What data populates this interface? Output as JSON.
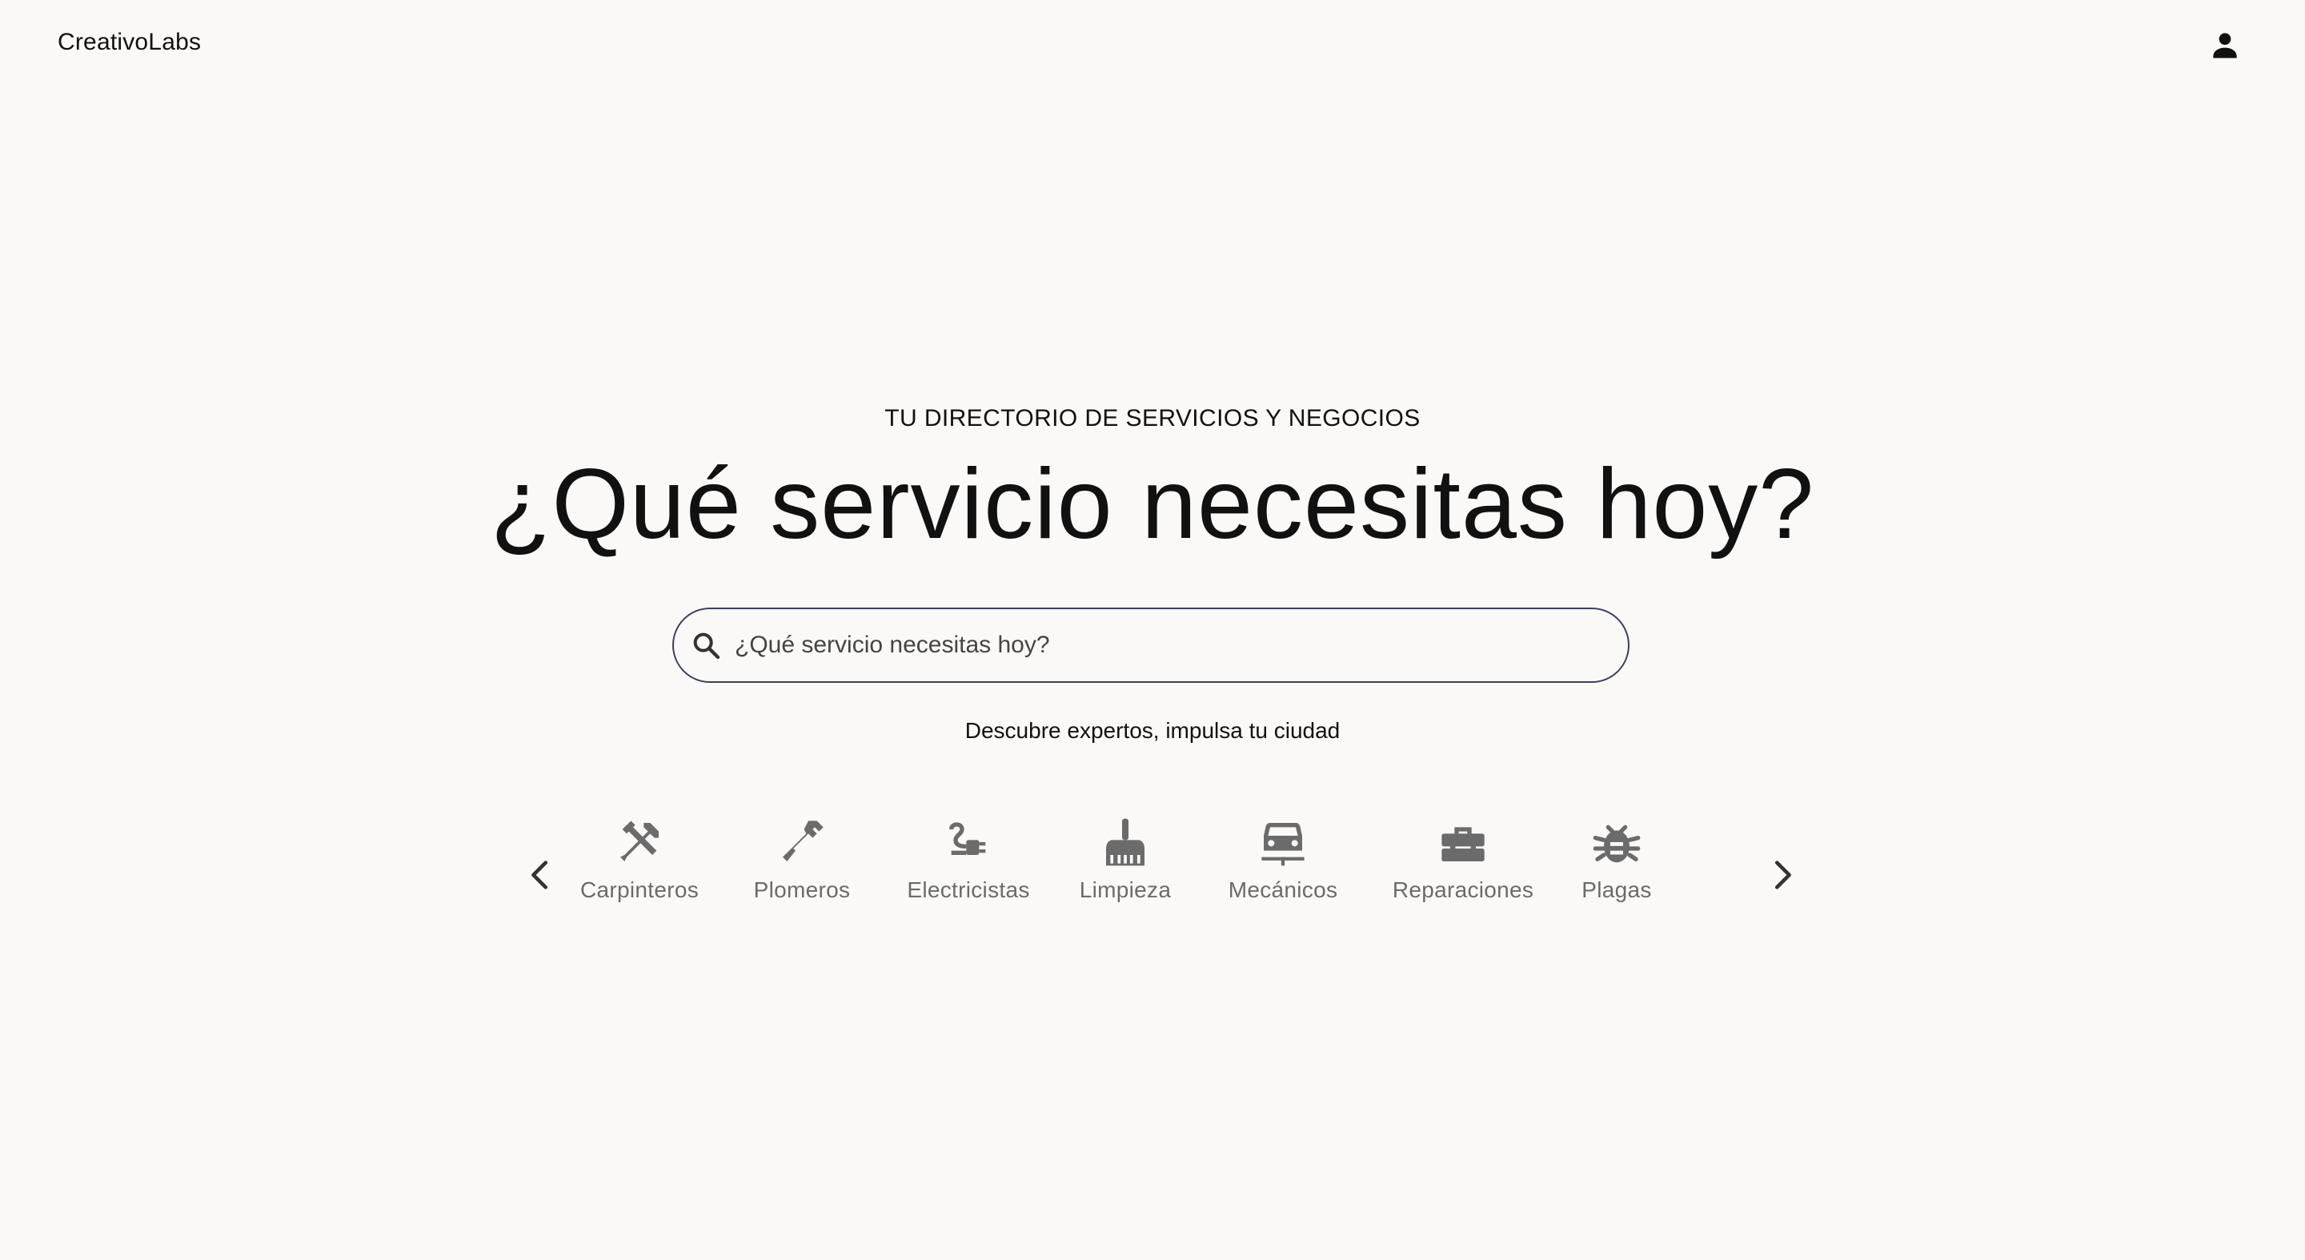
{
  "brand": "CreativoLabs",
  "header": {
    "account_icon": "person-icon"
  },
  "hero": {
    "eyebrow": "TU DIRECTORIO DE SERVICIOS Y NEGOCIOS",
    "headline": "¿Qué servicio necesitas hoy?",
    "search_placeholder": "¿Qué servicio necesitas hoy?",
    "tagline": "Descubre expertos, impulsa tu ciudad"
  },
  "categories": [
    {
      "label": "Carpinteros",
      "icon": "carpentry-tools-icon"
    },
    {
      "label": "Plomeros",
      "icon": "plumbing-wrench-icon"
    },
    {
      "label": "Electricistas",
      "icon": "electrical-plug-icon"
    },
    {
      "label": "Limpieza",
      "icon": "cleaning-broom-icon"
    },
    {
      "label": "Mecánicos",
      "icon": "car-icon"
    },
    {
      "label": "Reparaciones",
      "icon": "toolbox-icon"
    },
    {
      "label": "Plagas",
      "icon": "bug-icon"
    }
  ],
  "colors": {
    "background": "#faf9f7",
    "search_border": "#3e3d63",
    "icon_gray": "#6b6b6b",
    "text": "#111111"
  }
}
